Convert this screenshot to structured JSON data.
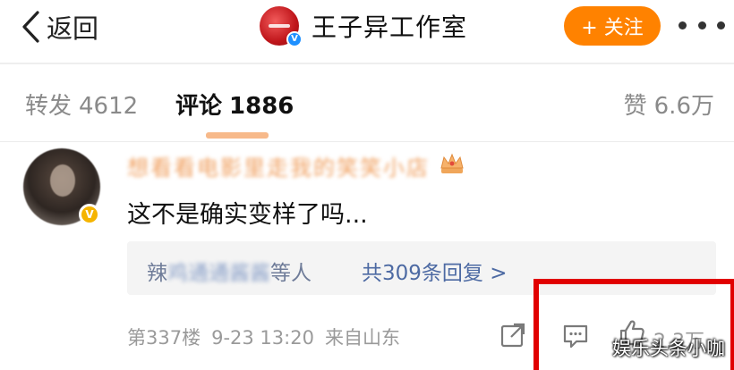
{
  "topbar": {
    "back_label": "返回",
    "account_name": "王子异工作室",
    "follow_label": "+ 关注"
  },
  "tabs": [
    {
      "label": "转发",
      "count": "4612"
    },
    {
      "label": "评论",
      "count": "1886"
    },
    {
      "label": "赞",
      "count": "6.6万"
    }
  ],
  "comment": {
    "author": "想看看电影里走我的笑笑小店",
    "text": "这不是确实变样了吗...",
    "replies": {
      "names_prefix": "辣",
      "names_blurred": "鸡通通酱酱",
      "names_suffix": "等人",
      "count_text": "共309条回复 >"
    },
    "meta": {
      "floor": "第337楼",
      "time": "9-23 13:20",
      "source": "来自山东"
    },
    "like_count": "2.3万"
  },
  "watermark": "娱乐头条小咖",
  "colors": {
    "follow": "#ff8200",
    "link": "#4d6aa3",
    "highlight_box": "#e10000"
  }
}
